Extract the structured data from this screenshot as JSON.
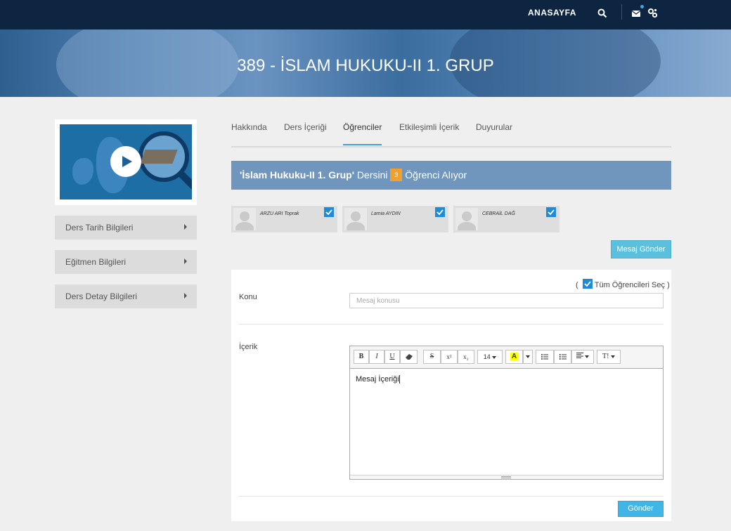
{
  "nav": {
    "home_label": "ANASAYFA"
  },
  "banner": {
    "title": "389 - İSLAM HUKUKU-II 1. GRUP"
  },
  "sidebar": {
    "items": [
      {
        "label": "Ders Tarih Bilgileri"
      },
      {
        "label": "Eğitmen Bilgileri"
      },
      {
        "label": "Ders Detay Bilgileri"
      }
    ]
  },
  "tabs": [
    {
      "label": "Hakkında"
    },
    {
      "label": "Ders İçeriği"
    },
    {
      "label": "Öğrenciler",
      "active": true
    },
    {
      "label": "Etkileşimli İçerik"
    },
    {
      "label": "Duyurular"
    }
  ],
  "enrollment": {
    "course": "'İslam Hukuku-II 1. Grup'",
    "pre": "Dersini",
    "count": "3",
    "post": "Öğrenci Alıyor"
  },
  "students": [
    {
      "name": "ARZU ARI Toprak",
      "selected": true
    },
    {
      "name": "Lamia AYDIN",
      "selected": true
    },
    {
      "name": "CEBRAİL DAĞ",
      "selected": true
    }
  ],
  "actions": {
    "send_message": "Mesaj Gönder",
    "submit": "Gönder"
  },
  "form": {
    "select_all_open": "(",
    "select_all_label": "Tüm Öğrencileri Seç",
    "select_all_close": ")",
    "subject_label": "Konu",
    "subject_placeholder": "Mesaj konusu",
    "content_label": "İçerik",
    "content_value": "Mesaj İçeriği",
    "font_size": "14"
  },
  "toolbar": {
    "bold": "B",
    "italic": "I",
    "underline": "U",
    "strike": "S",
    "superscript": "x²",
    "subscript": "x₂",
    "highlight": "A",
    "text_style": "T!"
  },
  "colors": {
    "nav_bg": "#0d2540",
    "header_bar": "#7196bd",
    "badge": "#f0a030",
    "button": "#5bc0de",
    "check": "#1d8bd8"
  }
}
